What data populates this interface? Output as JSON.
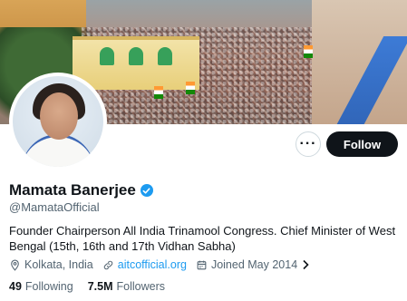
{
  "profile": {
    "name": "Mamata Banerjee",
    "handle": "@MamataOfficial",
    "bio": "Founder Chairperson All India Trinamool Congress. Chief Minister of West Bengal (15th, 16th and 17th Vidhan Sabha)",
    "location": "Kolkata, India",
    "website": "aitcofficial.org",
    "joined": "Joined May 2014",
    "following_count": "49",
    "following_label": "Following",
    "followers_count": "7.5M",
    "followers_label": "Followers"
  },
  "actions": {
    "more_label": "···",
    "follow_label": "Follow"
  },
  "icons": {
    "location": "location-pin-icon",
    "link": "link-icon",
    "calendar": "calendar-icon",
    "verified": "verified-badge-icon"
  },
  "colors": {
    "accent": "#1d9bf0",
    "follow_button": "#0f1419",
    "secondary_text": "#536471"
  }
}
